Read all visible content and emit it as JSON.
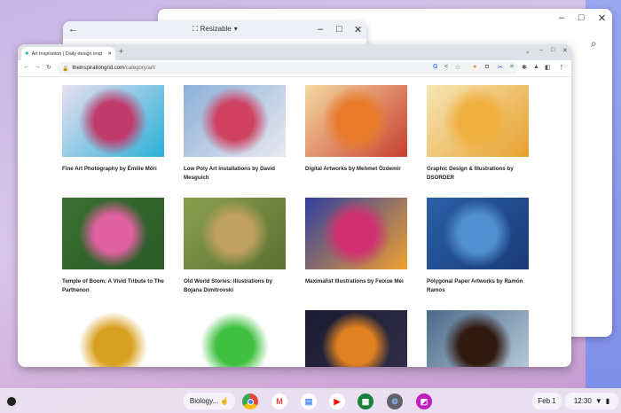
{
  "back_window": {
    "controls": [
      "minimize",
      "maximize",
      "close"
    ]
  },
  "mid_window": {
    "resize_label": "Resizable"
  },
  "browser": {
    "tab_title": "Art inspiration | Daily design insp",
    "url_domain": "theinspirationgrid.com",
    "url_path": "/category/art/"
  },
  "cards": [
    {
      "title": "Fine Art Photography by Émilie Möri",
      "colors": [
        "#e8e0f0",
        "#c03a6a",
        "#2ab0d8"
      ]
    },
    {
      "title": "Low Poly Art Installations by David Mesguich",
      "colors": [
        "#8ab0d8",
        "#d04060",
        "#e8e8f0"
      ]
    },
    {
      "title": "Digital Artworks by Mehmet Özdemir",
      "colors": [
        "#f5d9a0",
        "#e87a2a",
        "#c84030"
      ]
    },
    {
      "title": "Graphic Design & Illustrations by DSORDER",
      "colors": [
        "#f6e6b4",
        "#f0b040",
        "#e8a030"
      ]
    },
    {
      "title": "Temple of Boom: A Vivid Tribute to The Parthenon",
      "colors": [
        "#3a7030",
        "#e060a0",
        "#2a5a28"
      ]
    },
    {
      "title": "Old World Stories: Illustrations by Bojana Dimitrovski",
      "colors": [
        "#8aa050",
        "#c0a060",
        "#5a7030"
      ]
    },
    {
      "title": "Maximalist Illustrations by Feixue Mei",
      "colors": [
        "#3040a0",
        "#d03070",
        "#f0a030"
      ]
    },
    {
      "title": "Polygonal Paper Artworks by Ramón Ramos",
      "colors": [
        "#2a60a8",
        "#5090d0",
        "#1a3a78"
      ]
    },
    {
      "title": "",
      "colors": [
        "#ffffff",
        "#d8a020",
        "#ffffff"
      ]
    },
    {
      "title": "",
      "colors": [
        "#ffffff",
        "#40c040",
        "#ffffff"
      ]
    },
    {
      "title": "",
      "colors": [
        "#1a1a30",
        "#e08020",
        "#30304a"
      ]
    },
    {
      "title": "",
      "colors": [
        "#4a6a8a",
        "#301a10",
        "#c0d0e0"
      ]
    }
  ],
  "shelf": {
    "app_label": "Biology...",
    "date": "Feb 1",
    "time": "12:30",
    "apps": [
      "Chrome",
      "Gmail",
      "Docs",
      "YouTube",
      "Calculator",
      "Settings",
      "Canvas"
    ]
  }
}
